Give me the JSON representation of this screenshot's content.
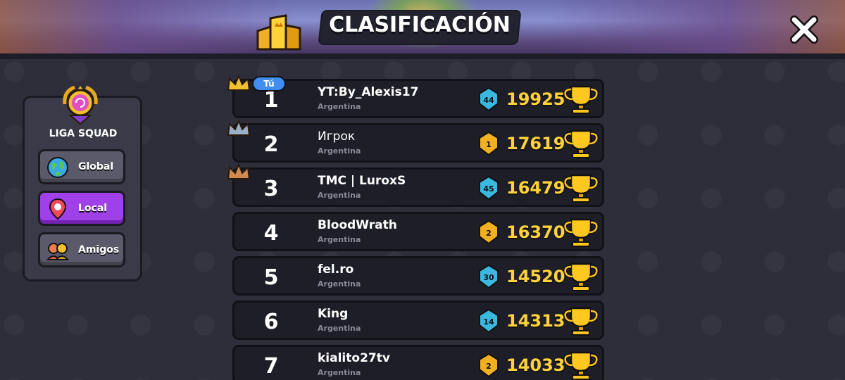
{
  "header": {
    "title": "CLASIFICACIÓN"
  },
  "league": {
    "name": "LIGA SQUAD"
  },
  "tabs": [
    {
      "label": "Global",
      "active": false,
      "icon": "globe-icon"
    },
    {
      "label": "Local",
      "active": true,
      "icon": "location-pin-icon"
    },
    {
      "label": "Amigos",
      "active": false,
      "icon": "friends-icon"
    }
  ],
  "you_badge": "Tú",
  "colors": {
    "accent_active": "#a040e8",
    "trophy": "#ffd23a",
    "you_badge": "#3f8ef0"
  },
  "rows": [
    {
      "rank": "1",
      "name": "YT:By_Alexis17",
      "country": "Argentina",
      "level": "44",
      "trophies": "19925"
    },
    {
      "rank": "2",
      "name": "Игрок",
      "country": "Argentina",
      "level": "1",
      "trophies": "17619"
    },
    {
      "rank": "3",
      "name": "TMC | LuroxS",
      "country": "Argentina",
      "level": "45",
      "trophies": "16479"
    },
    {
      "rank": "4",
      "name": "BloodWrath",
      "country": "Argentina",
      "level": "2",
      "trophies": "16370"
    },
    {
      "rank": "5",
      "name": "fel.ro",
      "country": "Argentina",
      "level": "30",
      "trophies": "14520"
    },
    {
      "rank": "6",
      "name": "King",
      "country": "Argentina",
      "level": "14",
      "trophies": "14313"
    },
    {
      "rank": "7",
      "name": "kialito27tv",
      "country": "Argentina",
      "level": "2",
      "trophies": "14033"
    }
  ]
}
